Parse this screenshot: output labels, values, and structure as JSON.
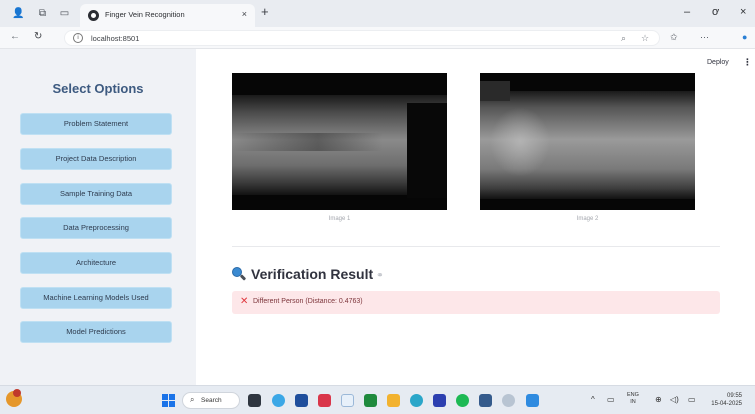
{
  "browser": {
    "tab_title": "Finger Vein Recognition",
    "tab_close": "×",
    "new_tab": "+",
    "url": "localhost:8501",
    "window_minimize": "–",
    "window_maximize": "ơ",
    "window_close": "×"
  },
  "sidebar": {
    "title": "Select Options",
    "buttons": [
      "Problem Statement",
      "Project Data Description",
      "Sample Training Data",
      "Data Preprocessing",
      "Architecture",
      "Machine Learning Models Used",
      "Model Predictions"
    ]
  },
  "main": {
    "deploy_label": "Deploy",
    "images": [
      {
        "caption": "Image 1"
      },
      {
        "caption": "Image 2"
      }
    ],
    "result_title": "Verification Result",
    "result_link_icon": "link-icon",
    "alert_icon": "cross-mark-icon",
    "alert_text": "Different Person (Distance: 0.4763)",
    "alert_bg": "#fde7e9",
    "accent": "#a9d4ee"
  },
  "taskbar": {
    "search_label": "Search",
    "lang_line1": "ENG",
    "lang_line2": "IN",
    "time": "09:55",
    "date": "15-04-2025"
  }
}
